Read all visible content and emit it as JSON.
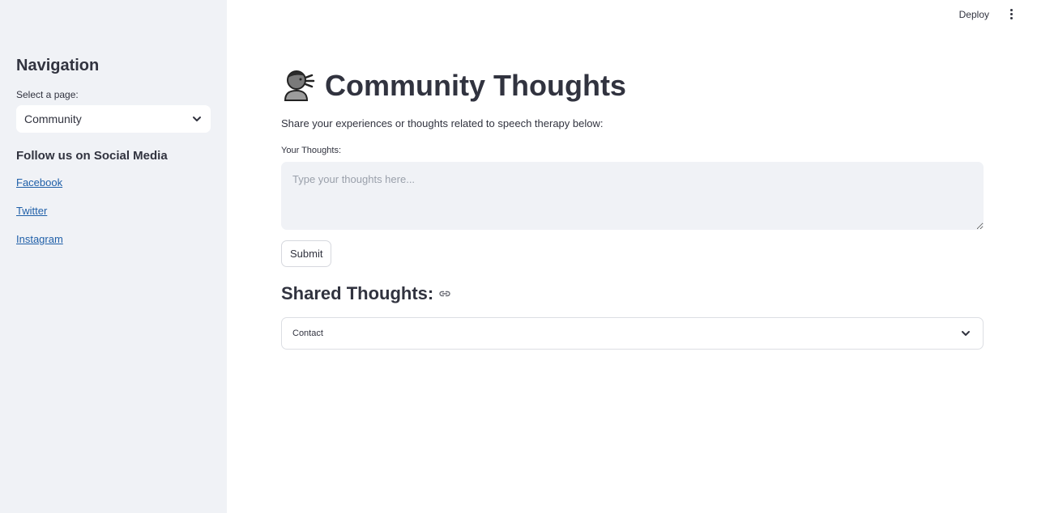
{
  "sidebar": {
    "title": "Navigation",
    "select_label": "Select a page:",
    "select_value": "Community",
    "social_title": "Follow us on Social Media",
    "links": [
      "Facebook",
      "Twitter",
      "Instagram"
    ]
  },
  "header": {
    "deploy_label": "Deploy"
  },
  "main": {
    "title": "Community Thoughts",
    "subtitle": "Share your experiences or thoughts related to speech therapy below:",
    "thoughts_label": "Your Thoughts:",
    "thoughts_placeholder": "Type your thoughts here...",
    "submit_label": "Submit",
    "shared_title": "Shared Thoughts:",
    "expander_label": "Contact"
  },
  "icons": {
    "title": "speaking-head-icon",
    "select_chevron": "chevron-down-icon",
    "shared_anchor": "link-icon",
    "expander_chevron": "chevron-down-icon",
    "menu": "vertical-dots-icon"
  },
  "colors": {
    "sidebar_bg": "#f0f2f6",
    "text": "#31333f",
    "link": "#1f5fa8"
  }
}
